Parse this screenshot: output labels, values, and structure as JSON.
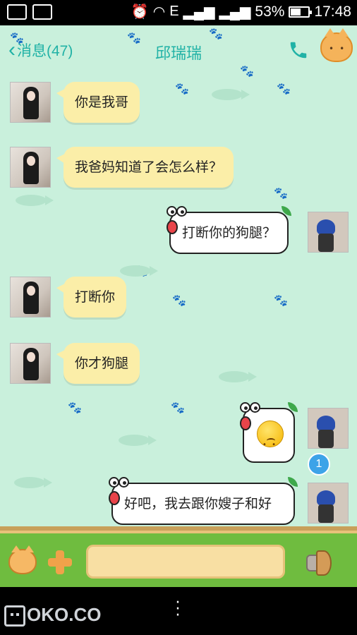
{
  "status_bar": {
    "battery_percent": "53%",
    "time": "17:48",
    "network_badge": "E"
  },
  "header": {
    "back_label": "消息(47)",
    "title": "邱瑞瑞"
  },
  "messages": [
    {
      "side": "in",
      "text": "你是我哥"
    },
    {
      "side": "in",
      "text": "我爸妈知道了会怎么样？"
    },
    {
      "side": "out",
      "text": "打断你的狗腿？"
    },
    {
      "side": "in",
      "text": "打断你"
    },
    {
      "side": "in",
      "text": "你才狗腿"
    },
    {
      "side": "out",
      "text": "",
      "emoji": "sad-face-emoji"
    },
    {
      "side": "out",
      "text": "好吧，我去跟你嫂子和好"
    }
  ],
  "unread_badge": "1",
  "input": {
    "value": "",
    "placeholder": ""
  },
  "watermark": "OKO.CO",
  "colors": {
    "chat_bg": "#c9f0dc",
    "accent": "#21b2a6",
    "incoming_bubble": "#fbeea8",
    "outgoing_bubble": "#ffffff"
  }
}
